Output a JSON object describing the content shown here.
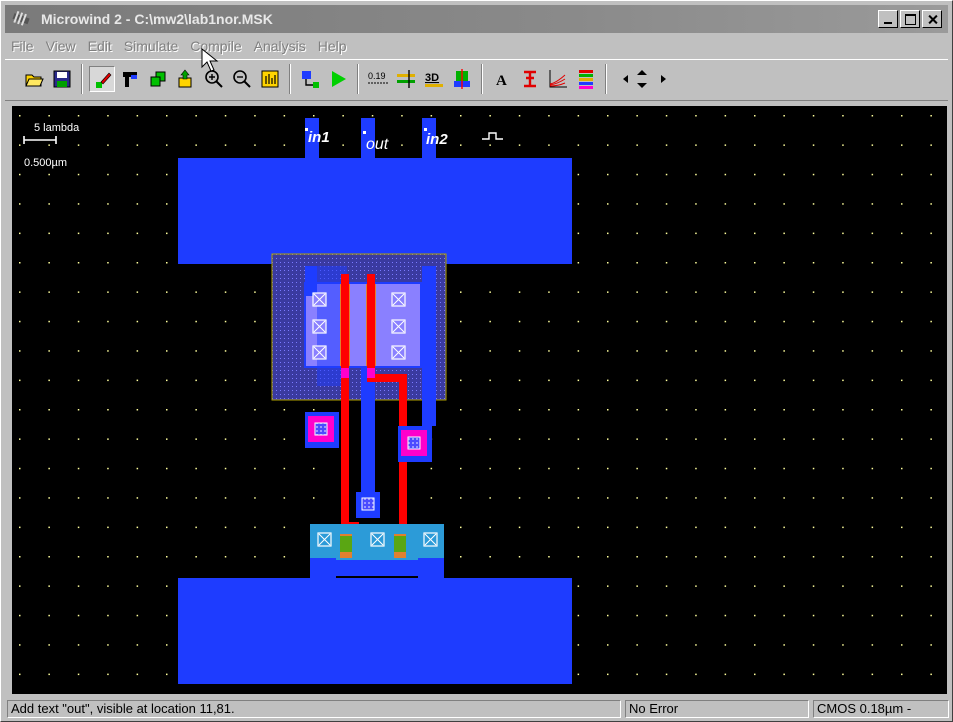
{
  "window": {
    "title": "Microwind 2 - C:\\mw2\\lab1nor.MSK"
  },
  "menu": [
    {
      "label": "File"
    },
    {
      "label": "View"
    },
    {
      "label": "Edit"
    },
    {
      "label": "Simulate"
    },
    {
      "label": "Compile"
    },
    {
      "label": "Analysis"
    },
    {
      "label": "Help"
    }
  ],
  "toolbar": {
    "icons": [
      "open-folder-icon",
      "save-icon",
      "draw-box-icon",
      "add-contact-icon",
      "copy-icon",
      "move-icon",
      "zoom-in-icon",
      "zoom-out-icon",
      "view-all-icon",
      "extract-icon",
      "run-simulation-icon",
      "measure-icon",
      "distance-icon",
      "3d-view-icon",
      "2d-cut-icon",
      "text-icon",
      "connection-icon",
      "mos-characteristics-icon",
      "palette-icon",
      "navigate-arrows-icon"
    ],
    "measure_label": "0.19"
  },
  "scale": {
    "label": "5 lambda",
    "value": "0.500µm"
  },
  "layout": {
    "labels": {
      "in1": "in1",
      "out": "out",
      "in2": "in2"
    },
    "clock_symbol": "⎍"
  },
  "colors": {
    "metal1": "#1e3cff",
    "polysilicon": "#ff0000",
    "diffusion_n": "#2c9bd8",
    "diffusion_p": "#8a80ff",
    "contact_pink": "#ff00cc",
    "nwell_outline": "#b0a000",
    "grid_dot": "#ffff9c"
  },
  "status": {
    "message": "Add text \"out\", visible at location 11,81.",
    "error": "No Error",
    "technology": "CMOS 0.18µm -"
  }
}
